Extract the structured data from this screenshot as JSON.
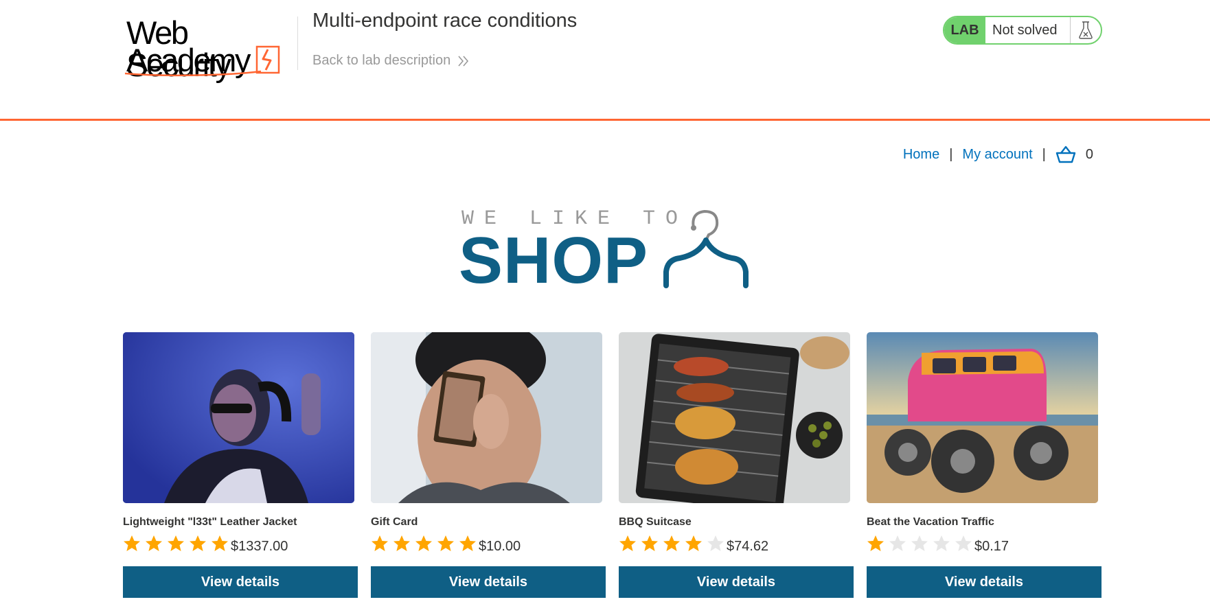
{
  "header": {
    "logo_text_top": "Web Security",
    "logo_text_bottom": "Academy",
    "lab_title": "Multi-endpoint race conditions",
    "back_link": "Back to lab description",
    "lab_badge": "LAB",
    "lab_status": "Not solved",
    "accent_color": "#ff6633",
    "status_color": "#70d16d"
  },
  "nav": {
    "home": "Home",
    "separator": "|",
    "my_account": "My account",
    "cart_count": "0"
  },
  "banner": {
    "small": "WE LIKE TO",
    "big": "SHOP"
  },
  "products": [
    {
      "name": "Lightweight \"l33t\" Leather Jacket",
      "rating": 5,
      "price": "$1337.00",
      "button": "View details",
      "image": "woman-headphones-leather-jacket"
    },
    {
      "name": "Gift Card",
      "rating": 5,
      "price": "$10.00",
      "button": "View details",
      "image": "man-holding-card"
    },
    {
      "name": "BBQ Suitcase",
      "rating": 4,
      "price": "$74.62",
      "button": "View details",
      "image": "portable-grill"
    },
    {
      "name": "Beat the Vacation Traffic",
      "rating": 1,
      "price": "$0.17",
      "button": "View details",
      "image": "monster-truck-van"
    }
  ]
}
